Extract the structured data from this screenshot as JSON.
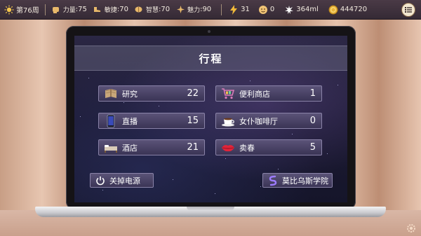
{
  "status_bar": {
    "week": "第76周",
    "strength_label": "力量",
    "strength_value": ":75",
    "agility_label": "敏捷",
    "agility_value": ":70",
    "wisdom_label": "智慧",
    "wisdom_value": ":70",
    "charm_label": "魅力",
    "charm_value": ":90",
    "energy": "31",
    "face_count": "0",
    "volume": "364ml",
    "coins": "444720"
  },
  "schedule": {
    "title": "行程",
    "items_left": [
      {
        "label": "研究",
        "value": "22",
        "icon": "book-icon"
      },
      {
        "label": "直播",
        "value": "15",
        "icon": "phone-icon"
      },
      {
        "label": "酒店",
        "value": "21",
        "icon": "hotel-bed-icon"
      }
    ],
    "items_right": [
      {
        "label": "便利商店",
        "value": "1",
        "icon": "shopping-cart-icon"
      },
      {
        "label": "女仆咖啡厅",
        "value": "0",
        "icon": "coffee-cup-icon"
      },
      {
        "label": "卖春",
        "value": "5",
        "icon": "lips-icon"
      }
    ],
    "power_off_label": "关掉电源",
    "academy_label": "莫比乌斯学院"
  },
  "colors": {
    "panel_top": "#5b5378",
    "panel_bottom": "#3a3455",
    "panel_border": "#8a83a8",
    "topbar": "#3c2f3b",
    "text": "#ffffff"
  }
}
